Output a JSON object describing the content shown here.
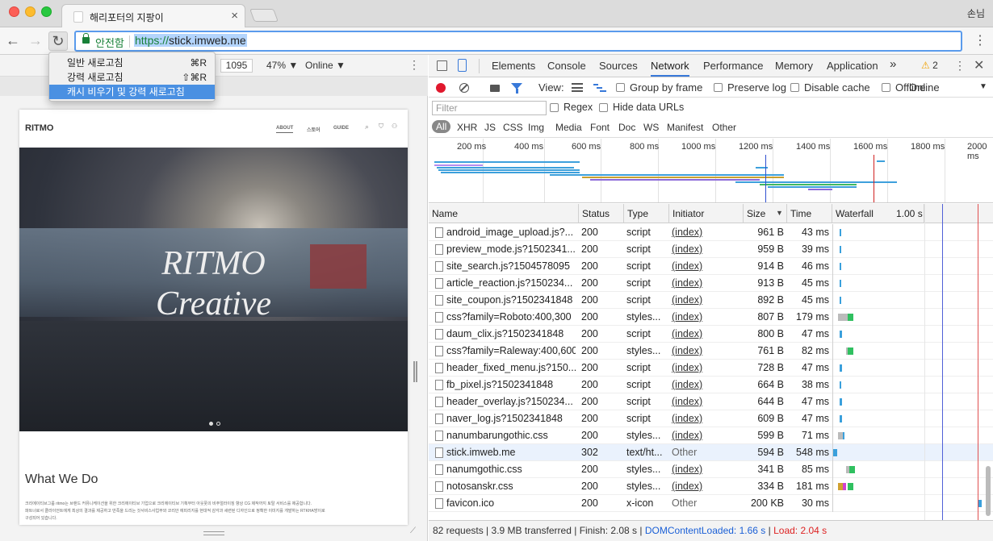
{
  "browser": {
    "tab_title": "해리포터의 지팡이",
    "profile": "손님",
    "secure_label": "안전함",
    "url_scheme": "https://",
    "url_host": "stick.imweb.me"
  },
  "reload_menu": {
    "items": [
      {
        "label": "일반 새로고침",
        "shortcut": "⌘R"
      },
      {
        "label": "강력 새로고침",
        "shortcut": "⇧⌘R"
      },
      {
        "label": "캐시 비우기 및 강력 새로고침",
        "shortcut": ""
      }
    ]
  },
  "device_toolbar": {
    "width": "1095",
    "zoom": "47% ▼",
    "throttle": "Online ▼"
  },
  "site": {
    "logo": "RITMO",
    "nav": [
      "ABOUT",
      "스토어",
      "GUIDE"
    ],
    "hero_line1": "RITMO",
    "hero_line2": "Creative",
    "section_title": "What We Do",
    "body_lines": [
      "크리에이티브그룹 ritmo는 브랜드 커뮤니케이션을 위한 크리에이티브 기업으로 크리에이티브 기획부터 아웃풋의 비주얼라이징 향상 CG 제작까지 토탈 서비스를 제공합니다.",
      "파트너로서 클라이언트에게 최상의 결과를 제공하고 만족을 드리는 것서비스사업부와 코리안 에피리지를 현대적 감각과 세련된 디자인으로 정확한 이미지를 개발하는 RTKHA방이로",
      "구성되어 있습니다."
    ]
  },
  "devtools": {
    "tabs": [
      "Elements",
      "Console",
      "Sources",
      "Network",
      "Performance",
      "Memory",
      "Application"
    ],
    "more": "»",
    "warnings": "2",
    "view_label": "View:",
    "checkboxes": [
      "Group by frame",
      "Preserve log",
      "Disable cache",
      "Offline"
    ],
    "throttle": "Online",
    "filter_placeholder": "Filter",
    "filter_checkboxes": [
      "Regex",
      "Hide data URLs"
    ],
    "types": [
      "All",
      "XHR",
      "JS",
      "CSS",
      "Img",
      "Media",
      "Font",
      "Doc",
      "WS",
      "Manifest",
      "Other"
    ],
    "overview_ticks": [
      "200 ms",
      "400 ms",
      "600 ms",
      "800 ms",
      "1000 ms",
      "1200 ms",
      "1400 ms",
      "1600 ms",
      "1800 ms",
      "2000 ms"
    ],
    "columns": [
      "Name",
      "Status",
      "Type",
      "Initiator",
      "Size",
      "Time",
      "Waterfall"
    ],
    "waterfall_scale": "1.00 s",
    "rows": [
      {
        "name": "android_image_upload.js?...",
        "status": "200",
        "type": "script",
        "initiator": "(index)",
        "size": "961 B",
        "time": "43 ms"
      },
      {
        "name": "preview_mode.js?1502341...",
        "status": "200",
        "type": "script",
        "initiator": "(index)",
        "size": "959 B",
        "time": "39 ms"
      },
      {
        "name": "site_search.js?1504578095",
        "status": "200",
        "type": "script",
        "initiator": "(index)",
        "size": "914 B",
        "time": "46 ms"
      },
      {
        "name": "article_reaction.js?150234...",
        "status": "200",
        "type": "script",
        "initiator": "(index)",
        "size": "913 B",
        "time": "45 ms"
      },
      {
        "name": "site_coupon.js?1502341848",
        "status": "200",
        "type": "script",
        "initiator": "(index)",
        "size": "892 B",
        "time": "45 ms"
      },
      {
        "name": "css?family=Roboto:400,300",
        "status": "200",
        "type": "styles...",
        "initiator": "(index)",
        "size": "807 B",
        "time": "179 ms"
      },
      {
        "name": "daum_clix.js?1502341848",
        "status": "200",
        "type": "script",
        "initiator": "(index)",
        "size": "800 B",
        "time": "47 ms"
      },
      {
        "name": "css?family=Raleway:400,600",
        "status": "200",
        "type": "styles...",
        "initiator": "(index)",
        "size": "761 B",
        "time": "82 ms"
      },
      {
        "name": "header_fixed_menu.js?150...",
        "status": "200",
        "type": "script",
        "initiator": "(index)",
        "size": "728 B",
        "time": "47 ms"
      },
      {
        "name": "fb_pixel.js?1502341848",
        "status": "200",
        "type": "script",
        "initiator": "(index)",
        "size": "664 B",
        "time": "38 ms"
      },
      {
        "name": "header_overlay.js?150234...",
        "status": "200",
        "type": "script",
        "initiator": "(index)",
        "size": "644 B",
        "time": "47 ms"
      },
      {
        "name": "naver_log.js?1502341848",
        "status": "200",
        "type": "script",
        "initiator": "(index)",
        "size": "609 B",
        "time": "47 ms"
      },
      {
        "name": "nanumbarungothic.css",
        "status": "200",
        "type": "styles...",
        "initiator": "(index)",
        "size": "599 B",
        "time": "71 ms"
      },
      {
        "name": "stick.imweb.me",
        "status": "302",
        "type": "text/ht...",
        "initiator": "Other",
        "size": "594 B",
        "time": "548 ms"
      },
      {
        "name": "nanumgothic.css",
        "status": "200",
        "type": "styles...",
        "initiator": "(index)",
        "size": "341 B",
        "time": "85 ms"
      },
      {
        "name": "notosanskr.css",
        "status": "200",
        "type": "styles...",
        "initiator": "(index)",
        "size": "334 B",
        "time": "181 ms"
      },
      {
        "name": "favicon.ico",
        "status": "200",
        "type": "x-icon",
        "initiator": "Other",
        "size": "200 KB",
        "time": "30 ms"
      }
    ],
    "status_bar": {
      "requests": "82 requests",
      "transferred": "3.9 MB transferred",
      "finish": "Finish: 2.08 s",
      "dcl": "DOMContentLoaded: 1.66 s",
      "load": "Load: 2.04 s"
    }
  }
}
